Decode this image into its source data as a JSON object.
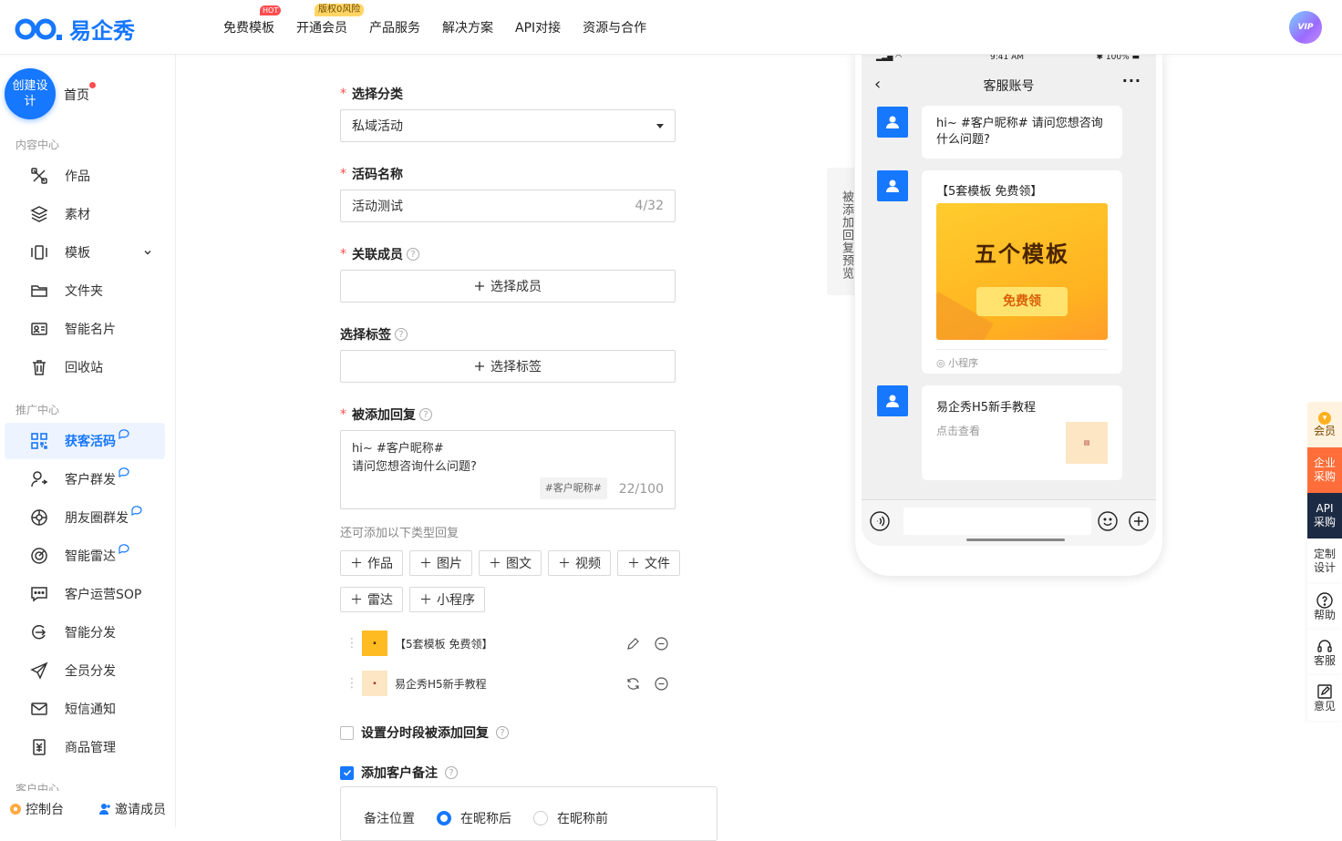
{
  "brand": {
    "name": "易企秀",
    "accent": "#1677ff"
  },
  "nav": {
    "items": [
      {
        "label": "免费模板",
        "badge": "HOT"
      },
      {
        "label": "开通会员",
        "badge": "版权0风险"
      },
      {
        "label": "产品服务"
      },
      {
        "label": "解决方案"
      },
      {
        "label": "API对接"
      },
      {
        "label": "资源与合作"
      }
    ],
    "vip_label": "VIP"
  },
  "sidebar": {
    "create_label": "创建设计",
    "home_label": "首页",
    "section_content": "内容中心",
    "content_items": [
      {
        "label": "作品",
        "icon": "works-icon"
      },
      {
        "label": "素材",
        "icon": "layers-icon"
      },
      {
        "label": "模板",
        "icon": "template-icon"
      },
      {
        "label": "文件夹",
        "icon": "folder-icon"
      },
      {
        "label": "智能名片",
        "icon": "card-icon"
      },
      {
        "label": "回收站",
        "icon": "trash-icon"
      }
    ],
    "section_promo": "推广中心",
    "promo_items": [
      {
        "label": "获客活码",
        "icon": "qrcode-icon"
      },
      {
        "label": "客户群发",
        "icon": "user-send-icon"
      },
      {
        "label": "朋友圈群发",
        "icon": "moments-icon"
      },
      {
        "label": "智能雷达",
        "icon": "radar-icon"
      },
      {
        "label": "客户运营SOP",
        "icon": "chat-sop-icon"
      },
      {
        "label": "智能分发",
        "icon": "distribute-icon"
      },
      {
        "label": "全员分发",
        "icon": "send-icon"
      },
      {
        "label": "短信通知",
        "icon": "mail-icon"
      },
      {
        "label": "商品管理",
        "icon": "goods-icon"
      }
    ],
    "section_customer": "客户中心",
    "footer": {
      "console": "控制台",
      "invite": "邀请成员"
    }
  },
  "form": {
    "category": {
      "label": "选择分类",
      "value": "私域活动"
    },
    "code_name": {
      "label": "活码名称",
      "value": "活动测试",
      "count": "4/32"
    },
    "members": {
      "label": "关联成员",
      "button": "选择成员"
    },
    "tags": {
      "label": "选择标签",
      "button": "选择标签"
    },
    "auto_reply": {
      "label": "被添加回复",
      "line1": "hi~ #客户昵称#",
      "line2": "请问您想咨询什么问题?",
      "chip": "#客户昵称#",
      "count": "22/100"
    },
    "more_hint": "还可添加以下类型回复",
    "add_buttons": [
      "作品",
      "图片",
      "图文",
      "视频",
      "文件",
      "雷达",
      "小程序"
    ],
    "reply_items": [
      {
        "title": "【5套模板 免费领】"
      },
      {
        "title": "易企秀H5新手教程"
      }
    ],
    "schedule_label": "设置分时段被添加回复",
    "remark_label": "添加客户备注",
    "remark_position_label": "备注位置",
    "remark_after": "在昵称后",
    "remark_before": "在昵称前"
  },
  "preview": {
    "tab_label": "被添加回复预览",
    "status_time": "9:41 AM",
    "status_battery": "100%",
    "chat_title": "客服账号",
    "msg_text": "hi~ #客户昵称# 请问您想咨询什么问题?",
    "mini_title": "【5套模板 免费领】",
    "banner_title": "五个模板",
    "banner_button": "免费领",
    "mini_source": "小程序",
    "link_title": "易企秀H5新手教程",
    "link_desc": "点击查看"
  },
  "float_bar": {
    "vip": "会员",
    "enterprise": "企业采购",
    "api": "API采购",
    "custom": "定制设计",
    "help": "帮助",
    "service": "客服",
    "feedback": "意见"
  }
}
